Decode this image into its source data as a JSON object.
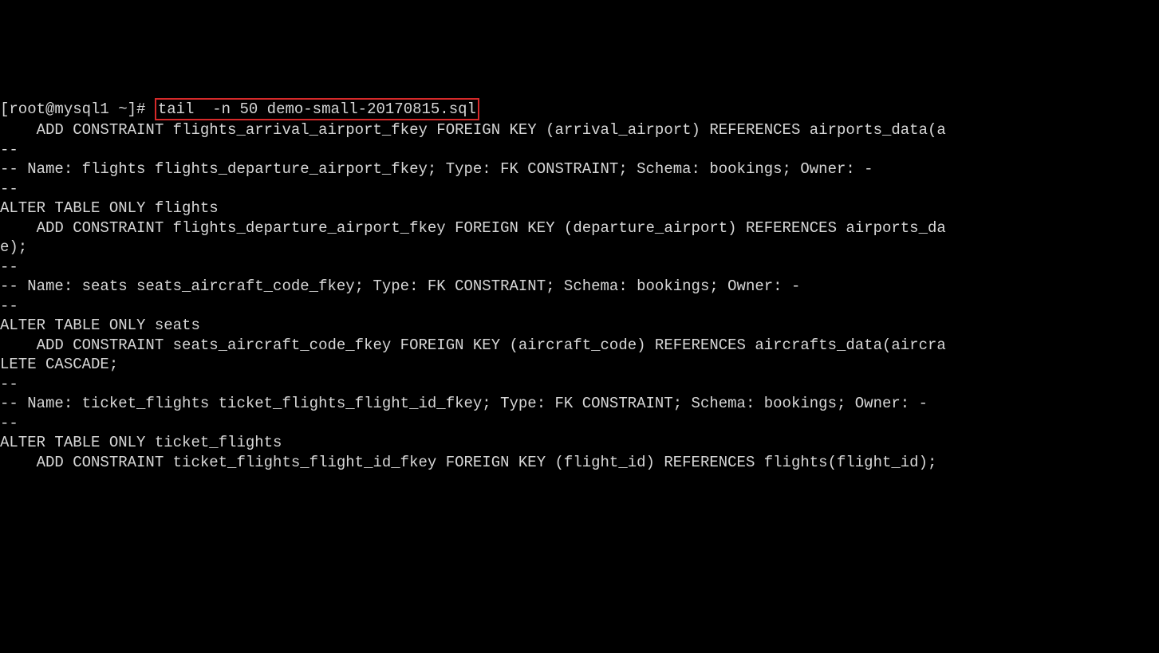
{
  "terminal": {
    "prompt": "[root@mysql1 ~]# ",
    "command": "tail  -n 50 demo-small-20170815.sql",
    "prompt_line_text": "[root@mysql1 ~]# tail  -n 50 demo-small-20170815.sql",
    "l01": "    ADD CONSTRAINT flights_arrival_airport_fkey FOREIGN KEY (arrival_airport) REFERENCES airports_data(a",
    "l02": "",
    "l03": "",
    "l04": "--",
    "l05": "-- Name: flights flights_departure_airport_fkey; Type: FK CONSTRAINT; Schema: bookings; Owner: -",
    "l06": "--",
    "l07": "",
    "l08": "ALTER TABLE ONLY flights",
    "l09": "    ADD CONSTRAINT flights_departure_airport_fkey FOREIGN KEY (departure_airport) REFERENCES airports_da",
    "l10": "e);",
    "l11": "",
    "l12": "",
    "l13": "--",
    "l14": "-- Name: seats seats_aircraft_code_fkey; Type: FK CONSTRAINT; Schema: bookings; Owner: -",
    "l15": "--",
    "l16": "",
    "l17": "ALTER TABLE ONLY seats",
    "l18": "    ADD CONSTRAINT seats_aircraft_code_fkey FOREIGN KEY (aircraft_code) REFERENCES aircrafts_data(aircra",
    "l19": "LETE CASCADE;",
    "l20": "",
    "l21": "",
    "l22": "--",
    "l23": "-- Name: ticket_flights ticket_flights_flight_id_fkey; Type: FK CONSTRAINT; Schema: bookings; Owner: -",
    "l24": "--",
    "l25": "",
    "l26": "ALTER TABLE ONLY ticket_flights",
    "l27": "    ADD CONSTRAINT ticket_flights_flight_id_fkey FOREIGN KEY (flight_id) REFERENCES flights(flight_id);"
  }
}
